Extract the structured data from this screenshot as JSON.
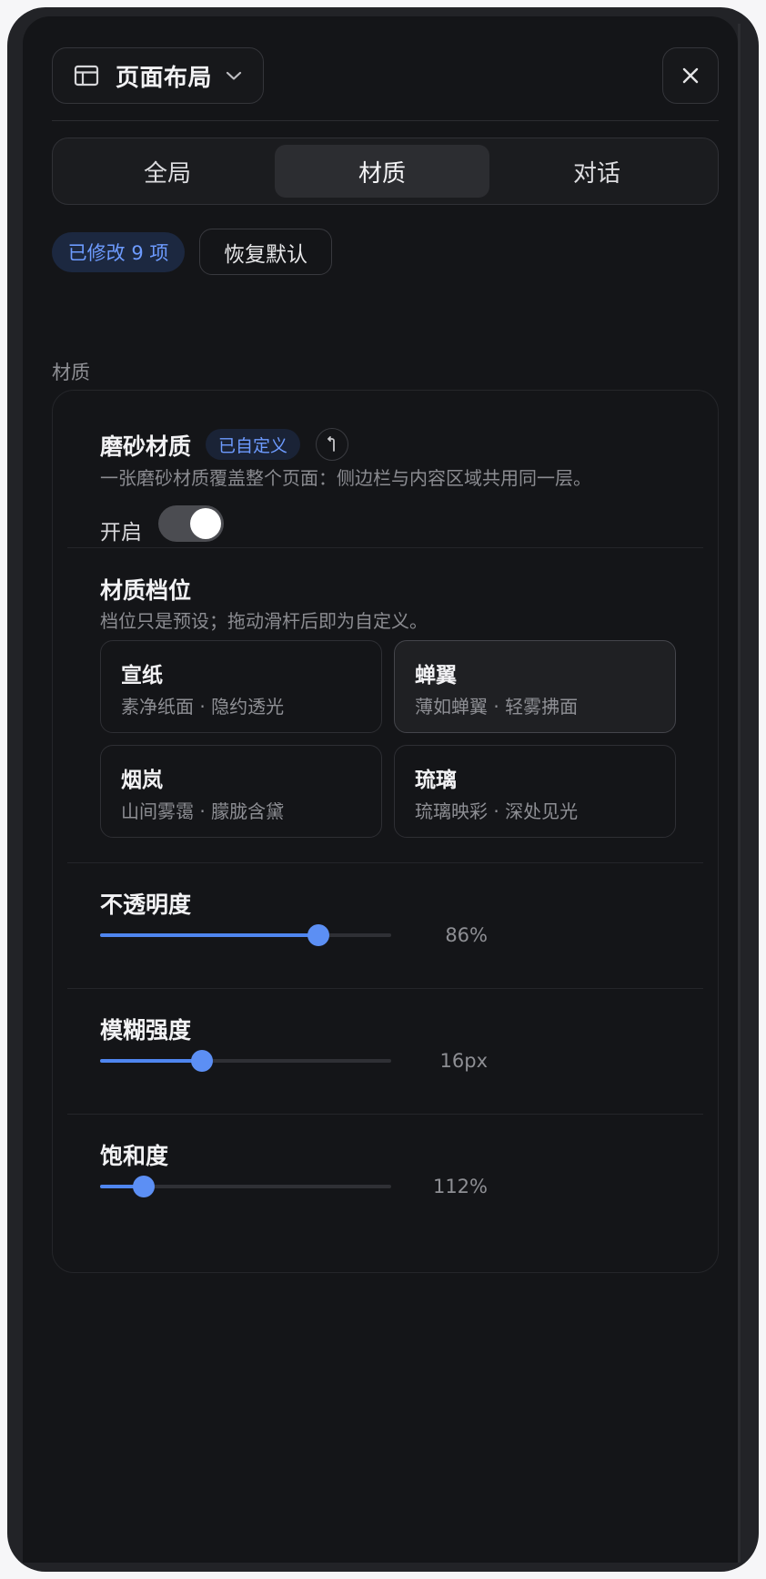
{
  "header": {
    "title": "页面布局",
    "layout_icon": "layout-icon",
    "chevron_icon": "chevron-down-icon",
    "close_icon": "close-icon"
  },
  "tabs": [
    {
      "label": "全局",
      "active": false
    },
    {
      "label": "材质",
      "active": true
    },
    {
      "label": "对话",
      "active": false
    }
  ],
  "status": {
    "modified_label": "已修改 9 项",
    "reset_label": "恢复默认"
  },
  "section": {
    "label": "材质"
  },
  "frosted": {
    "title": "磨砂材质",
    "badge": "已自定义",
    "undo_icon": "undo-icon",
    "description": "一张磨砂材质覆盖整个页面：侧边栏与内容区域共用同一层。",
    "toggle_label": "开启",
    "enabled": true
  },
  "presets": {
    "title": "材质档位",
    "description": "档位只是预设；拖动滑杆后即为自定义。",
    "items": [
      {
        "name": "宣纸",
        "desc": "素净纸面 · 隐约透光",
        "selected": false
      },
      {
        "name": "蝉翼",
        "desc": "薄如蝉翼 · 轻雾拂面",
        "selected": true
      },
      {
        "name": "烟岚",
        "desc": "山间雾霭 · 朦胧含黛",
        "selected": false
      },
      {
        "name": "琉璃",
        "desc": "琉璃映彩 · 深处见光",
        "selected": false
      }
    ]
  },
  "sliders": [
    {
      "title": "不透明度",
      "value_label": "86%",
      "fraction": 0.75
    },
    {
      "title": "模糊强度",
      "value_label": "16px",
      "fraction": 0.35
    },
    {
      "title": "饱和度",
      "value_label": "112%",
      "fraction": 0.15
    }
  ],
  "colors": {
    "accent": "#5c8ff4",
    "badge_text": "#6d9bff",
    "panel_background": "#141518"
  }
}
